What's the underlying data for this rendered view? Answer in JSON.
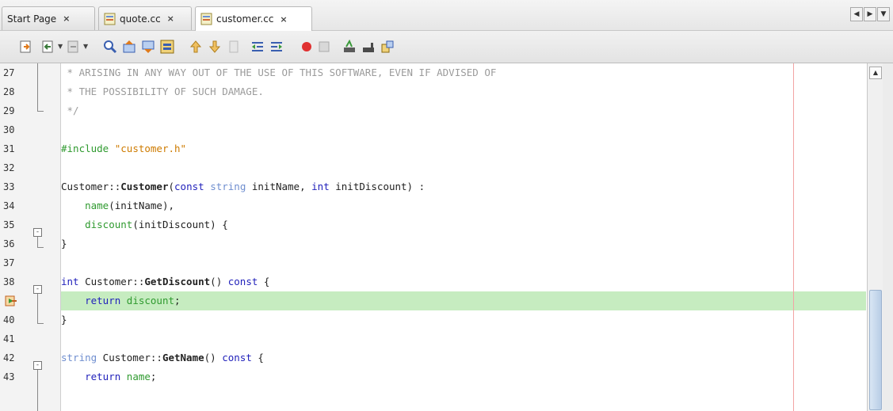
{
  "tabs": [
    {
      "label": "Start Page",
      "close": "×",
      "active": false,
      "icon": "none"
    },
    {
      "label": "quote.cc",
      "close": "×",
      "active": false,
      "icon": "cc-file-icon"
    },
    {
      "label": "customer.cc",
      "close": "×",
      "active": true,
      "icon": "cc-file-icon"
    }
  ],
  "tab_nav": {
    "left": "◀",
    "right": "▶",
    "menu": "▼"
  },
  "toolbar_icons": [
    "last-edit-icon",
    "back-icon",
    "forward-icon",
    "find-selection-icon",
    "find-previous-icon",
    "find-next-icon",
    "toggle-highlight-icon",
    "previous-bookmark-icon",
    "next-bookmark-icon",
    "toggle-bookmark-icon",
    "shift-left-icon",
    "shift-right-icon",
    "start-macro-icon",
    "stop-macro-icon",
    "comment-icon",
    "uncomment-icon",
    "diff-icon"
  ],
  "gutter": {
    "line_numbers": [
      "27",
      "28",
      "29",
      "30",
      "31",
      "32",
      "33",
      "34",
      "35",
      "36",
      "37",
      "38",
      "",
      "40",
      "41",
      "42",
      "43"
    ],
    "current_line_marker": "program-counter-icon"
  },
  "code": {
    "l27": " * ARISING IN ANY WAY OUT OF THE USE OF THIS SOFTWARE, EVEN IF ADVISED OF",
    "l28": " * THE POSSIBILITY OF SUCH DAMAGE.",
    "l29": " */",
    "l31_pp": "#include",
    "l31_str": "\"customer.h\"",
    "l33_a": "Customer::",
    "l33_b": "Customer",
    "l33_c": "(",
    "l33_d": "const",
    "l33_e": " ",
    "l33_f": "string",
    "l33_g": " initName, ",
    "l33_h": "int",
    "l33_i": " initDiscount) :",
    "l34_a": "name",
    "l34_b": "(initName),",
    "l35_a": "discount",
    "l35_b": "(initDiscount) {",
    "l36": "}",
    "l38_a": "int",
    "l38_b": " Customer::",
    "l38_c": "GetDiscount",
    "l38_d": "() ",
    "l38_e": "const",
    "l38_f": " {",
    "l39_a": "return",
    "l39_b": " ",
    "l39_c": "discount",
    "l39_d": ";",
    "l40": "}",
    "l42_a": "string",
    "l42_b": " Customer::",
    "l42_c": "GetName",
    "l42_d": "() ",
    "l42_e": "const",
    "l42_f": " {",
    "l43_a": "return",
    "l43_b": " ",
    "l43_c": "name",
    "l43_d": ";"
  },
  "fold_marker": "-",
  "scrollbar": {
    "up": "▲"
  },
  "colors": {
    "highlight": "#c6ecc0",
    "keyword": "#2222bb",
    "comment": "#9b9b9b",
    "string": "#ce7b00",
    "preprocessor": "#2f9a2f"
  }
}
